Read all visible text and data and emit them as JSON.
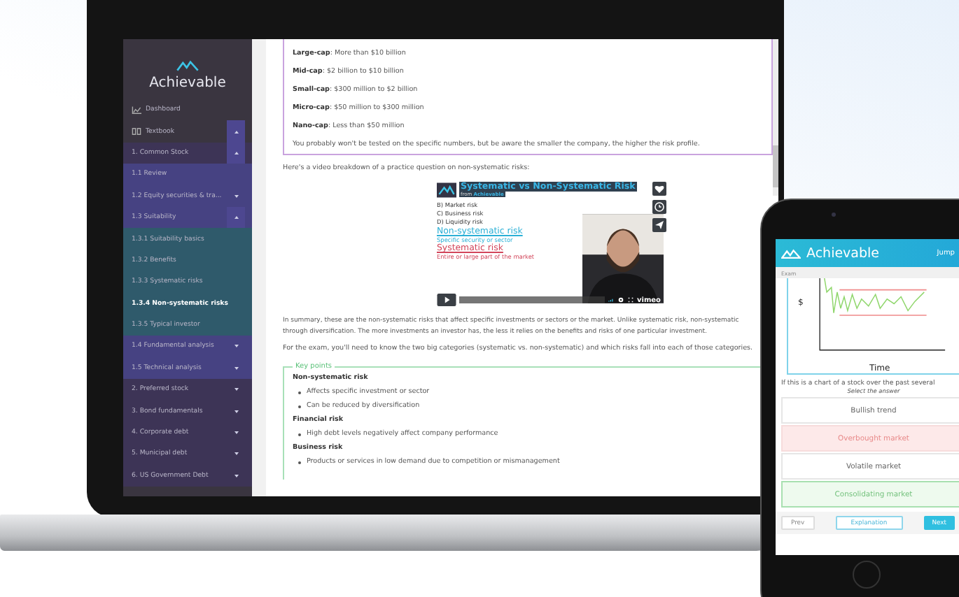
{
  "laptop": {
    "sidebar": {
      "brand": "Achievable",
      "items": [
        {
          "label": "Dashboard"
        },
        {
          "label": "Textbook",
          "expanded": true,
          "children": [
            {
              "label": "1. Common Stock",
              "expanded": true,
              "children": [
                {
                  "label": "1.1 Review"
                },
                {
                  "label": "1.2 Equity securities & tra...",
                  "expanded": false
                },
                {
                  "label": "1.3 Suitability",
                  "expanded": true,
                  "children": [
                    {
                      "label": "1.3.1 Suitability basics",
                      "selected": false
                    },
                    {
                      "label": "1.3.2 Benefits",
                      "selected": false
                    },
                    {
                      "label": "1.3.3 Systematic risks",
                      "selected": false
                    },
                    {
                      "label": "1.3.4 Non-systematic risks",
                      "selected": true
                    },
                    {
                      "label": "1.3.5 Typical investor",
                      "selected": false
                    }
                  ]
                },
                {
                  "label": "1.4 Fundamental analysis",
                  "expanded": false
                },
                {
                  "label": "1.5 Technical analysis",
                  "expanded": false
                }
              ]
            },
            {
              "label": "2. Preferred stock",
              "expanded": false
            },
            {
              "label": "3. Bond fundamentals",
              "expanded": false
            },
            {
              "label": "4. Corporate debt",
              "expanded": false
            },
            {
              "label": "5. Municipal debt",
              "expanded": false
            },
            {
              "label": "6. US Government Debt",
              "expanded": false
            }
          ]
        }
      ]
    },
    "content": {
      "cap_box": {
        "items": [
          "**Large-cap**: More than $10 billion",
          "**Mid-cap**: $2 billion to $10 billion",
          "**Small-cap**: $300 million to $2 billion",
          "**Micro-cap**: $50 million to $300 million",
          "**Nano-cap**: Less than $50 million"
        ],
        "note": "You probably won't be tested on the specific numbers, but be aware the smaller the company, the higher the risk profile."
      },
      "intro": "Here's a video breakdown of a practice question on non-systematic risks:",
      "video": {
        "title": "Systematic vs Non-Systematic Risk",
        "byline": "from ",
        "channel": "Achievable",
        "choices": [
          "B) Market risk",
          "C) Business risk",
          "D) Liquidity risk"
        ],
        "lines": [
          {
            "text": "Non-systematic risk",
            "kind": "heading",
            "color": "#2bb0d6"
          },
          {
            "text": "Specific security or sector",
            "kind": "sub"
          },
          {
            "text": "Systematic risk",
            "kind": "heading",
            "color": "#d2455a"
          },
          {
            "text": "Entire or large part of the market",
            "kind": "sub"
          }
        ],
        "player": "vimeo"
      },
      "summary": [
        "In summary, these are the non-systematic risks that affect specific investments or sectors or the market. Unlike systematic risk, non-systematic",
        "through diversification. The more investments an investor has, the less it relies on the benefits and risks of one particular investment."
      ],
      "exam": "For the exam, you'll need to know the two big categories (systematic vs. non-systematic) and which risks fall into each of those categories.",
      "key_points": {
        "legend": "Key points",
        "sections": [
          {
            "heading": "Non-systematic risk",
            "bullets": [
              "Affects specific investment or sector",
              "Can be reduced by diversification"
            ]
          },
          {
            "heading": "Financial risk",
            "bullets": [
              "High debt levels negatively affect company performance"
            ]
          },
          {
            "heading": "Business risk",
            "bullets": [
              "Products or services in low demand due to competition or mismanagement"
            ]
          }
        ]
      }
    }
  },
  "phone": {
    "brand": "Achievable",
    "jump": "Jump",
    "subbar": "Exam",
    "chart": {
      "ylabel": "$",
      "xlabel": "Time"
    },
    "question": "If this is a chart of a stock over the past several",
    "instruction": "Select the answer",
    "answers": [
      {
        "label": "Bullish trend",
        "selected": false,
        "correct": false
      },
      {
        "label": "Overbought market",
        "selected": true,
        "correct": false
      },
      {
        "label": "Volatile market",
        "selected": false,
        "correct": false
      },
      {
        "label": "Consolidating market",
        "selected": false,
        "correct": true
      }
    ],
    "buttons": [
      {
        "label": "Prev",
        "kind": "plain"
      },
      {
        "label": "Explanation",
        "kind": "outline"
      },
      {
        "label": "Next",
        "kind": "primary"
      }
    ]
  }
}
